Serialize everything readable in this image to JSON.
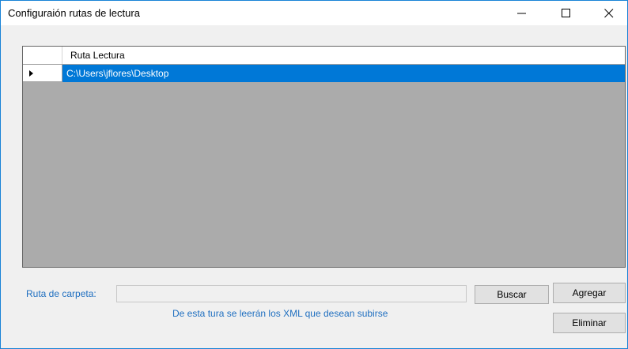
{
  "window": {
    "title": "Configuraión rutas de lectura",
    "controls": {
      "minimize_icon": "minimize-icon",
      "maximize_icon": "maximize-icon",
      "close_icon": "close-icon"
    }
  },
  "grid": {
    "columns": [
      "Ruta Lectura"
    ],
    "rows": [
      {
        "selected": true,
        "ruta": "C:\\Users\\jflores\\Desktop"
      }
    ]
  },
  "form": {
    "ruta_label": "Ruta de carpeta:",
    "ruta_value": "",
    "hint": "De esta tura se leerán los XML que desean subirse",
    "buscar_label": "Buscar",
    "agregar_label": "Agregar",
    "eliminar_label": "Eliminar"
  },
  "colors": {
    "accent": "#0078d7",
    "label_text": "#1f6fc0",
    "grid_background": "#ababab"
  }
}
